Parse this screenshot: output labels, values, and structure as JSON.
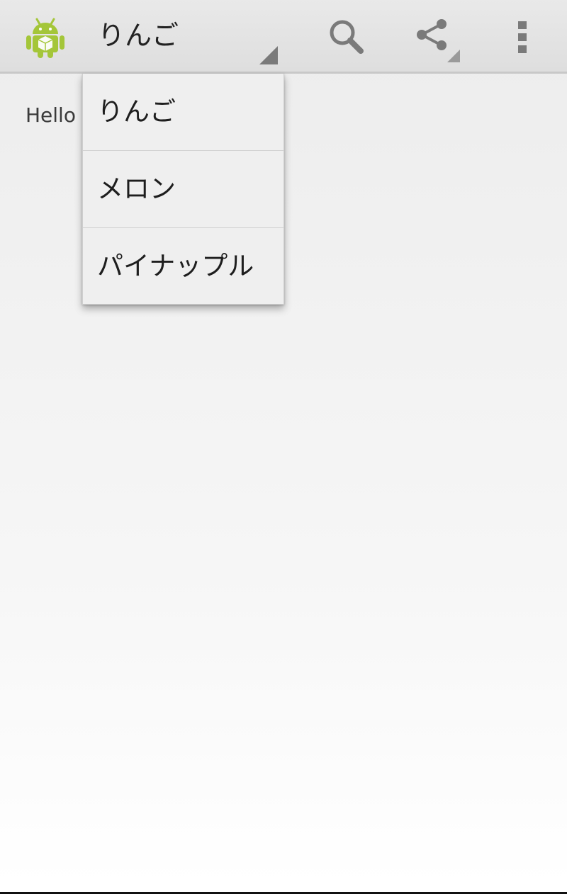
{
  "action_bar": {
    "app_icon": "android-icon",
    "nav_spinner": {
      "selected": "りんご"
    },
    "actions": [
      {
        "icon": "search-icon"
      },
      {
        "icon": "share-icon"
      },
      {
        "icon": "overflow-menu-icon"
      }
    ]
  },
  "content": {
    "hello_text": "Hello"
  },
  "dropdown": {
    "items": [
      {
        "label": "りんご"
      },
      {
        "label": "メロン"
      },
      {
        "label": "パイナップル"
      }
    ]
  },
  "colors": {
    "android_green": "#a4c639",
    "icon_gray": "#7a7a7a",
    "action_bar_bg": "#e4e4e4"
  }
}
